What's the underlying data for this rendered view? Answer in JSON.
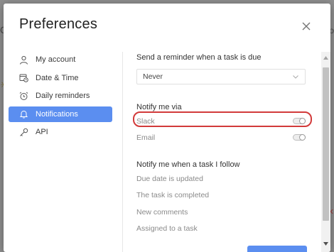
{
  "dialog": {
    "title": "Preferences",
    "close_icon": "close-icon"
  },
  "sidebar": {
    "items": [
      {
        "label": "My account",
        "icon": "user-icon",
        "active": false
      },
      {
        "label": "Date & Time",
        "icon": "calendar-clock-icon",
        "active": false
      },
      {
        "label": "Daily reminders",
        "icon": "alarm-clock-icon",
        "active": false
      },
      {
        "label": "Notifications",
        "icon": "bell-icon",
        "active": true
      },
      {
        "label": "API",
        "icon": "key-icon",
        "active": false
      }
    ]
  },
  "content": {
    "reminder": {
      "label": "Send a reminder when a task is due",
      "selected_value": "Never"
    },
    "notify_via": {
      "label": "Notify me via",
      "options": [
        {
          "label": "Slack",
          "enabled": false,
          "highlighted": true
        },
        {
          "label": "Email",
          "enabled": false,
          "highlighted": false
        }
      ]
    },
    "follow": {
      "label": "Notify me when a task I follow",
      "items": [
        "Due date is updated",
        "The task is completed",
        "New comments",
        "Assigned to a task"
      ]
    }
  },
  "colors": {
    "accent": "#5b8ef0",
    "highlight_outline": "#d23a3a",
    "backdrop": "#8f8f8f"
  }
}
